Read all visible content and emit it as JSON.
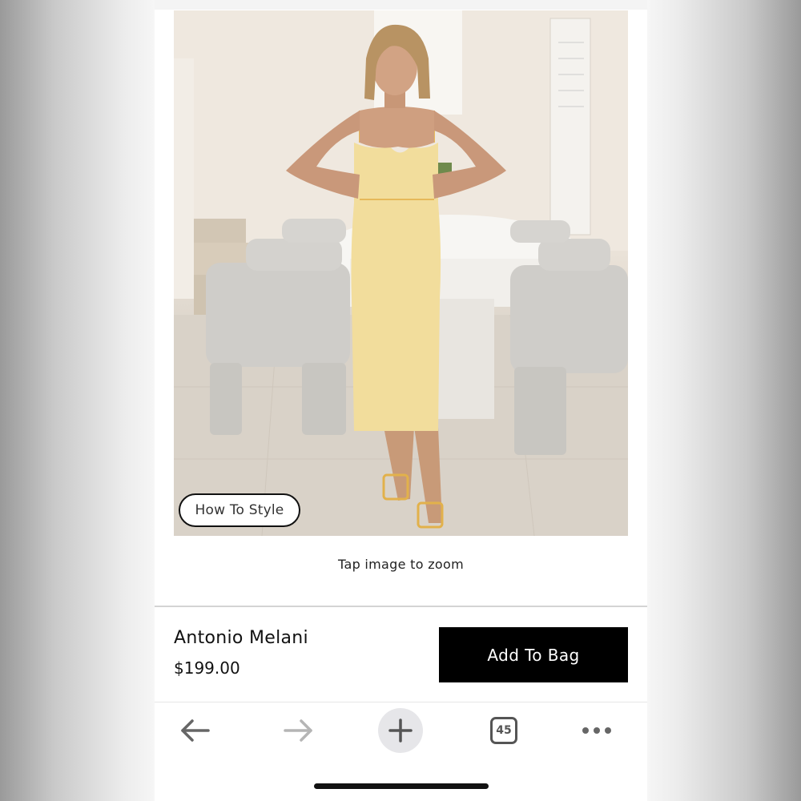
{
  "product": {
    "image_alt": "Model wearing a pale yellow midi dress with thin straps",
    "how_to_style_label": "How To Style",
    "zoom_hint": "Tap image to zoom",
    "brand": "Antonio Melani",
    "price": "$199.00",
    "add_to_bag_label": "Add To Bag"
  },
  "browser_toolbar": {
    "back_icon": "arrow-left-icon",
    "forward_icon": "arrow-right-icon",
    "new_tab_icon": "plus-icon",
    "tab_count": "45",
    "more_icon": "more-horizontal-icon"
  },
  "colors": {
    "accent_button": "#000000",
    "dress": "#f2dd9c",
    "page_background": "#ffffff"
  }
}
